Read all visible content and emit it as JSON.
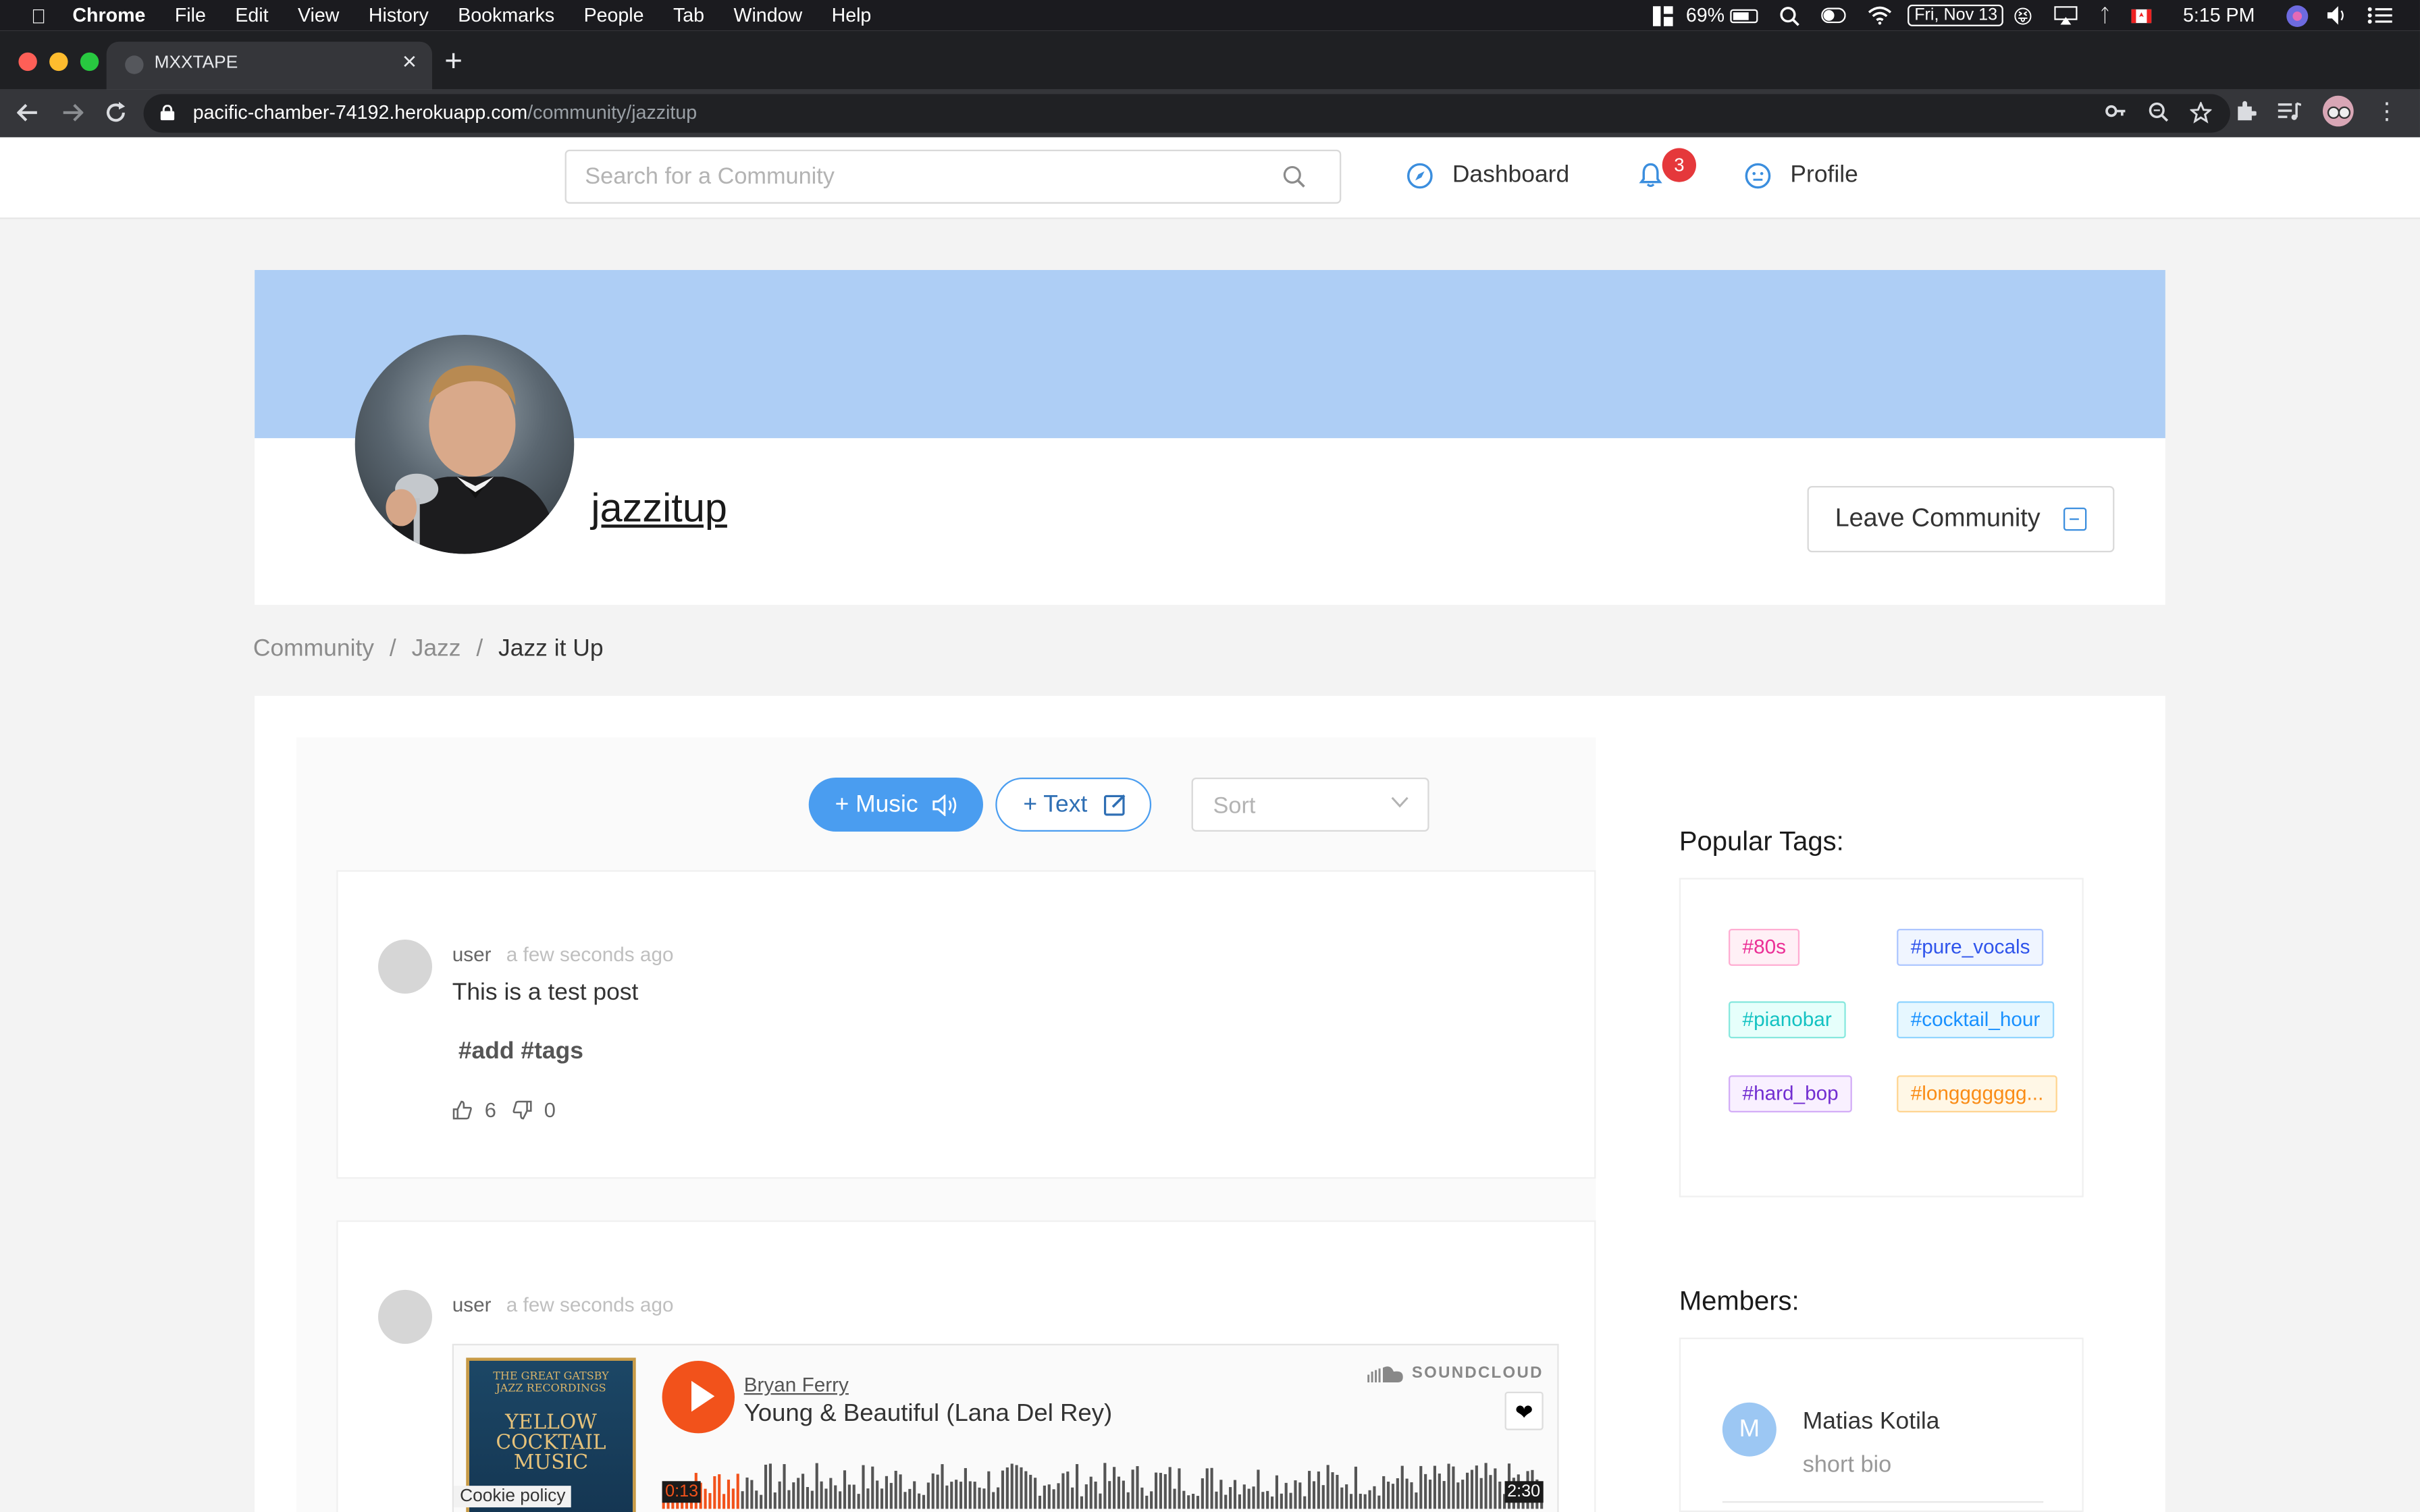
{
  "menubar": {
    "app": "Chrome",
    "items": [
      "File",
      "Edit",
      "View",
      "History",
      "Bookmarks",
      "People",
      "Tab",
      "Window",
      "Help"
    ],
    "battery": "69%",
    "date": "Fri, Nov 13",
    "time": "5:15 PM"
  },
  "browser": {
    "tab_title": "MXXTAPE",
    "url_host": "pacific-chamber-74192.herokuapp.com",
    "url_path": "/community/jazzitup"
  },
  "header": {
    "search_placeholder": "Search for a Community",
    "dashboard": "Dashboard",
    "notification_count": "3",
    "profile": "Profile"
  },
  "community": {
    "name": "jazzitup",
    "leave_label": "Leave Community",
    "banner_color": "#aecef5"
  },
  "breadcrumb": [
    "Community",
    "Jazz",
    "Jazz it Up"
  ],
  "feed": {
    "music_button": "+ Music",
    "text_button": "+ Text",
    "sort_placeholder": "Sort",
    "posts": [
      {
        "user": "user",
        "time": "a few seconds ago",
        "body": "This is a test post",
        "tags": "#add #tags",
        "likes": "6",
        "dislikes": "0"
      },
      {
        "user": "user",
        "time": "a few seconds ago",
        "player": {
          "artist": "Bryan Ferry",
          "track": "Young & Beautiful (Lana Del Rey)",
          "brand": "SOUNDCLOUD",
          "elapsed": "0:13",
          "duration": "2:30",
          "progress": 0.087,
          "art_line1": "THE GREAT GATSBY JAZZ RECORDINGS",
          "art_line2": "YELLOW COCKTAIL MUSIC",
          "cookie": "Cookie policy"
        }
      }
    ]
  },
  "sidebar": {
    "popular_title": "Popular Tags:",
    "tags": [
      {
        "label": "#80s",
        "color": "#eb2f96",
        "bg": "#fff0f6",
        "border": "#ffadd2"
      },
      {
        "label": "#pure_vocals",
        "color": "#2f54eb",
        "bg": "#f0f5ff",
        "border": "#adc6ff"
      },
      {
        "label": "#pianobar",
        "color": "#13c2c2",
        "bg": "#e6fffb",
        "border": "#87e8de"
      },
      {
        "label": "#cocktail_hour",
        "color": "#1890ff",
        "bg": "#e6f7ff",
        "border": "#91d5ff"
      },
      {
        "label": "#hard_bop",
        "color": "#722ed1",
        "bg": "#f9f0ff",
        "border": "#d3adf7"
      },
      {
        "label": "#longgggggg...",
        "color": "#fa8c16",
        "bg": "#fff7e6",
        "border": "#ffd591"
      }
    ],
    "members_title": "Members:",
    "members": [
      {
        "initial": "M",
        "name": "Matias Kotila",
        "bio": "short bio"
      }
    ]
  }
}
